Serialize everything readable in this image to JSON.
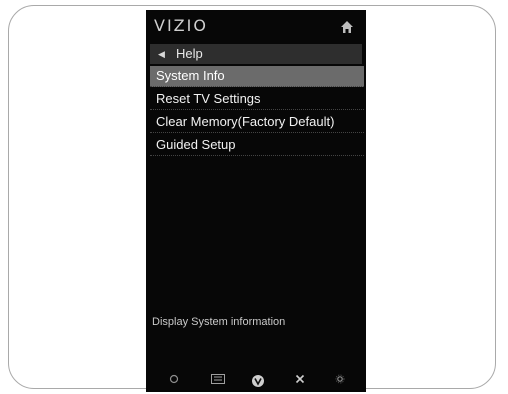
{
  "brand": "VIZIO",
  "breadcrumb": {
    "label": "Help",
    "back_icon": "left-arrow-icon"
  },
  "menu": {
    "items": [
      {
        "label": "System Info",
        "selected": true
      },
      {
        "label": "Reset TV Settings",
        "selected": false
      },
      {
        "label": "Clear Memory(Factory Default)",
        "selected": false
      },
      {
        "label": "Guided Setup",
        "selected": false
      }
    ]
  },
  "description": "Display System information",
  "bottom_bar": {
    "icons": [
      "ok-icon",
      "menu-grid-icon",
      "vizio-v-icon",
      "close-icon",
      "settings-icon"
    ]
  },
  "colors": {
    "screen_bg": "#070707",
    "selected_bg": "#6b6b6b",
    "text": "#f2f2f2"
  }
}
